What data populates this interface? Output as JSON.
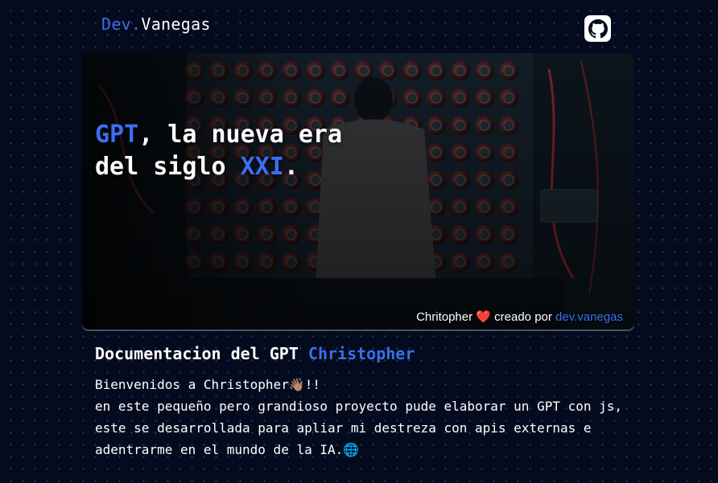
{
  "header": {
    "brand_prefix": "Dev.",
    "brand_name": "Vanegas",
    "github_icon": "github-icon"
  },
  "hero": {
    "title_word1": "GPT",
    "title_rest1": ", la nueva era",
    "title_line2_start": "del siglo ",
    "title_line2_accent": "XXI",
    "title_line2_end": ".",
    "credit_name": "Chritopher",
    "credit_icon": "heart-icon",
    "credit_middle": "creado por",
    "credit_link": "dev.vanegas"
  },
  "doc": {
    "title_start": "Documentacion del GPT ",
    "title_accent": "Christopher",
    "line1": "Bienvenidos a Christopher👋🏽!!",
    "line2": "en este pequeño pero grandioso proyecto pude elaborar un GPT con js, este se desarrollada para apliar mi destreza con apis externas e adentrarme en el mundo de la IA.🌐"
  },
  "colors": {
    "accent": "#3b6fe8",
    "background": "#050b1e",
    "heart": "#ff2b45"
  }
}
